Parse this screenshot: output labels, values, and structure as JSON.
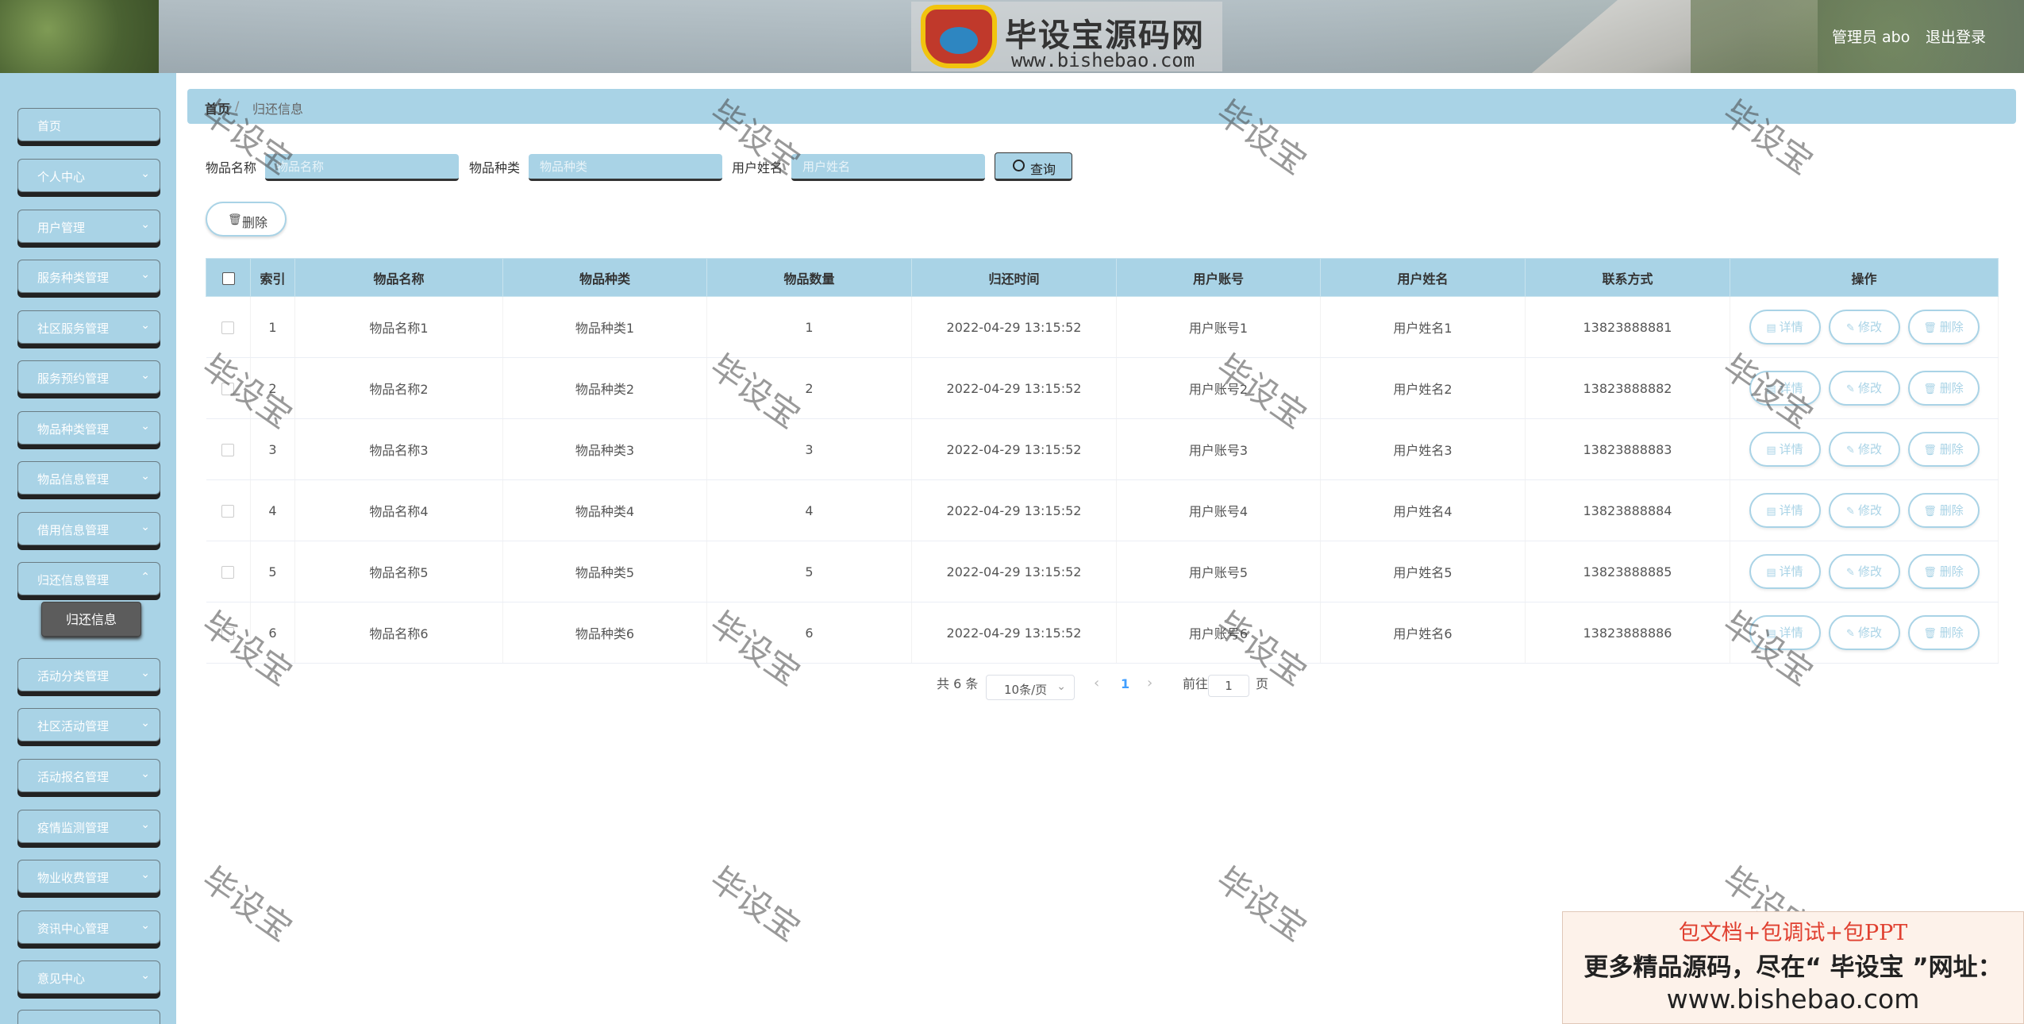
{
  "header": {
    "logo_title": "毕设宝源码网",
    "logo_url": "www.bishebao.com",
    "admin_name": "管理员 abo",
    "logout_label": "退出登录"
  },
  "sidebar": {
    "items": [
      {
        "label": "首页",
        "has_chevron": false
      },
      {
        "label": "个人中心",
        "has_chevron": true
      },
      {
        "label": "用户管理",
        "has_chevron": true
      },
      {
        "label": "服务种类管理",
        "has_chevron": true
      },
      {
        "label": "社区服务管理",
        "has_chevron": true
      },
      {
        "label": "服务预约管理",
        "has_chevron": true
      },
      {
        "label": "物品种类管理",
        "has_chevron": true
      },
      {
        "label": "物品信息管理",
        "has_chevron": true
      },
      {
        "label": "借用信息管理",
        "has_chevron": true
      },
      {
        "label": "归还信息管理",
        "has_chevron": true
      },
      {
        "label": "活动分类管理",
        "has_chevron": true
      },
      {
        "label": "社区活动管理",
        "has_chevron": true
      },
      {
        "label": "活动报名管理",
        "has_chevron": true
      },
      {
        "label": "疫情监测管理",
        "has_chevron": true
      },
      {
        "label": "物业收费管理",
        "has_chevron": true
      },
      {
        "label": "资讯中心管理",
        "has_chevron": true
      },
      {
        "label": "意见中心",
        "has_chevron": true
      }
    ],
    "active_sub_item": "归还信息"
  },
  "breadcrumb": {
    "home": "首页",
    "separator": "/",
    "current": "归还信息"
  },
  "search": {
    "fields": [
      {
        "label": "物品名称",
        "placeholder": "物品名称",
        "value": ""
      },
      {
        "label": "物品种类",
        "placeholder": "物品种类",
        "value": ""
      },
      {
        "label": "用户姓名",
        "placeholder": "用户姓名",
        "value": ""
      }
    ],
    "button_label": "查询"
  },
  "toolbar": {
    "delete_label": "删除"
  },
  "table": {
    "columns": [
      "索引",
      "物品名称",
      "物品种类",
      "物品数量",
      "归还时间",
      "用户账号",
      "用户姓名",
      "联系方式",
      "操作"
    ],
    "rows": [
      [
        "1",
        "物品名称1",
        "物品种类1",
        "1",
        "2022-04-29 13:15:52",
        "用户账号1",
        "用户姓名1",
        "13823888881"
      ],
      [
        "2",
        "物品名称2",
        "物品种类2",
        "2",
        "2022-04-29 13:15:52",
        "用户账号2",
        "用户姓名2",
        "13823888882"
      ],
      [
        "3",
        "物品名称3",
        "物品种类3",
        "3",
        "2022-04-29 13:15:52",
        "用户账号3",
        "用户姓名3",
        "13823888883"
      ],
      [
        "4",
        "物品名称4",
        "物品种类4",
        "4",
        "2022-04-29 13:15:52",
        "用户账号4",
        "用户姓名4",
        "13823888884"
      ],
      [
        "5",
        "物品名称5",
        "物品种类5",
        "5",
        "2022-04-29 13:15:52",
        "用户账号5",
        "用户姓名5",
        "13823888885"
      ],
      [
        "6",
        "物品名称6",
        "物品种类6",
        "6",
        "2022-04-29 13:15:52",
        "用户账号6",
        "用户姓名6",
        "13823888886"
      ]
    ],
    "row_actions": [
      "详情",
      "修改",
      "删除"
    ]
  },
  "pagination": {
    "total_text": "共 6 条",
    "page_size": "10条/页",
    "current_page": "1",
    "goto_label": "前往",
    "goto_value": "1",
    "page_suffix": "页"
  },
  "watermark": "毕设宝",
  "ad": {
    "line1": "包文档+包调试+包PPT",
    "line2": "更多精品源码，尽在“ 毕设宝 ”网址：",
    "line3": "www.bishebao.com"
  },
  "colors": {
    "accent": "#a9d3e6",
    "sidebar_bg": "#a9d3e6",
    "active_sub_bg": "#5c5c5c",
    "ad_red": "#e04030"
  }
}
